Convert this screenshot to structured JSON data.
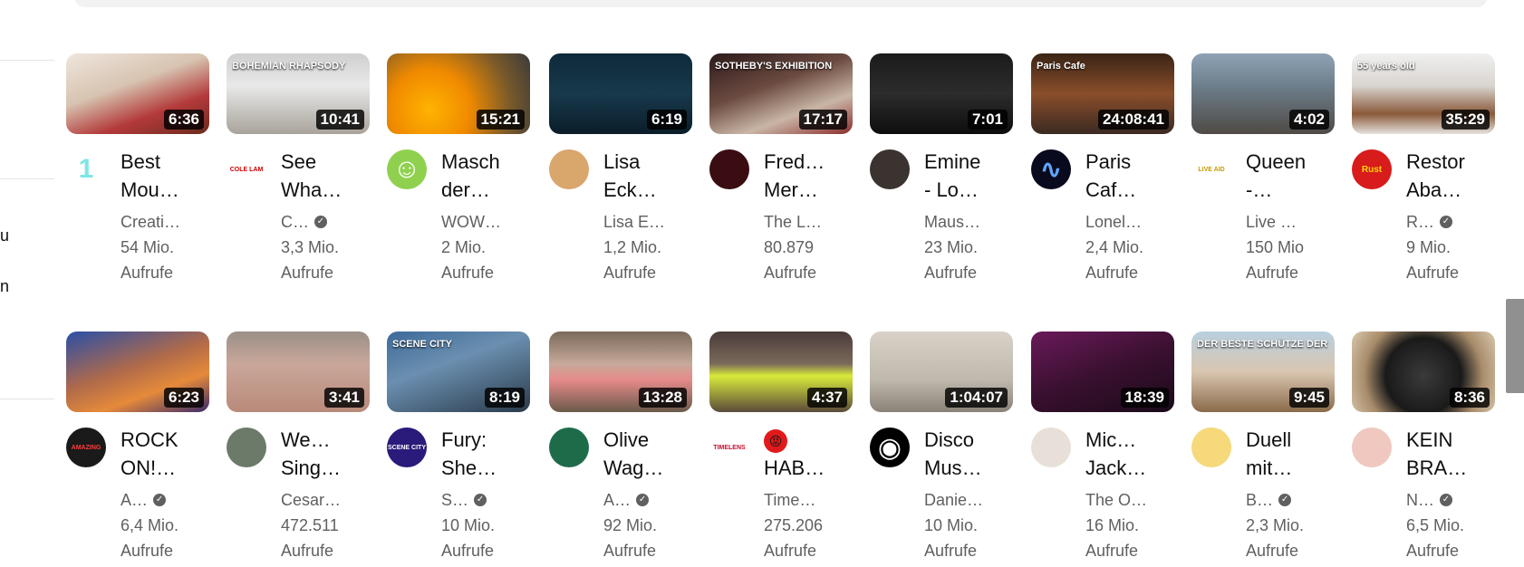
{
  "rail_texts": [
    "u",
    "n"
  ],
  "rows": [
    [
      {
        "duration": "6:36",
        "title1": "Best",
        "title2": "Mou…",
        "channel": "Creati…",
        "verified": false,
        "views": "54 Mio.",
        "views_unit": "Aufrufe",
        "avatar_text": "1",
        "thumb": "linear-gradient(160deg,#efe6de 0%,#d7c3b0 40%,#b33a3a 70%,#6b2b1e 100%)",
        "avatar_bg": "#ffffff",
        "avatar_fg": "#7fe6e6",
        "thumb_label": ""
      },
      {
        "duration": "10:41",
        "title1": "See",
        "title2": "Wha…",
        "channel": "C…",
        "verified": true,
        "views": "3,3 Mio.",
        "views_unit": "Aufrufe",
        "avatar_text": "COLE LAM",
        "thumb": "linear-gradient(180deg,#cfcfcf 0%,#e9e9e9 40%,#a8a39a 100%)",
        "avatar_bg": "#ffffff",
        "avatar_fg": "#d00000",
        "thumb_label": "BOHEMIAN RHAPSODY"
      },
      {
        "duration": "15:21",
        "title1": "Masch",
        "title2": "der…",
        "channel": "WOW…",
        "verified": false,
        "views": "2 Mio.",
        "views_unit": "Aufrufe",
        "avatar_text": "☺",
        "thumb": "radial-gradient(circle at 30% 70%,#ffb300 0%,#f08a00 35%,#7a5a2a 70%,#3a3a3a 100%)",
        "avatar_bg": "#8fd14f",
        "avatar_fg": "#ffffff",
        "thumb_label": ""
      },
      {
        "duration": "6:19",
        "title1": "Lisa",
        "title2": "Eckh…",
        "channel": "Lisa E…",
        "verified": false,
        "views": "1,2 Mio.",
        "views_unit": "Aufrufe",
        "avatar_text": "",
        "thumb": "linear-gradient(180deg,#0e2a3a 0%,#17394c 50%,#0b1d29 100%)",
        "avatar_bg": "#d9a66c",
        "avatar_fg": "#ffffff",
        "thumb_label": ""
      },
      {
        "duration": "17:17",
        "title1": "Freddie",
        "title2": "Mer…",
        "channel": "The L…",
        "verified": false,
        "views": "80.879",
        "views_unit": "Aufrufe",
        "avatar_text": "",
        "thumb": "linear-gradient(160deg,#2b1a1a 0%,#6b4a40 40%,#c9b6a6 70%,#8a2d2d 100%)",
        "avatar_bg": "#3a0d12",
        "avatar_fg": "#ffffff",
        "thumb_label": "SOTHEBY'S EXHIBITION"
      },
      {
        "duration": "7:01",
        "title1": "Emine",
        "title2": "- Los…",
        "channel": "Maus…",
        "verified": false,
        "views": "23 Mio.",
        "views_unit": "Aufrufe",
        "avatar_text": "",
        "thumb": "linear-gradient(180deg,#1b1b1b 0%,#2c2c2c 50%,#0d0d0d 100%)",
        "avatar_bg": "#3a3330",
        "avatar_fg": "#ffffff",
        "thumb_label": ""
      },
      {
        "duration": "24:08:41",
        "title1": "Paris",
        "title2": "Cafe…",
        "channel": "Lonel…",
        "verified": false,
        "views": "2,4 Mio.",
        "views_unit": "Aufrufe",
        "avatar_text": "∿",
        "thumb": "linear-gradient(180deg,#3a2416 0%,#8a4e2a 50%,#3b2a22 100%)",
        "avatar_bg": "#0a0a1e",
        "avatar_fg": "#5fa8ff",
        "thumb_label": "Paris Cafe"
      },
      {
        "duration": "4:02",
        "title1": "Queen",
        "title2": "-…",
        "channel": "Live …",
        "verified": false,
        "views": "150 Mio",
        "views_unit": "Aufrufe",
        "avatar_text": "LIVE AID",
        "thumb": "linear-gradient(180deg,#8fa3b5 0%,#6d7f8c 40%,#4f4a45 100%)",
        "avatar_bg": "#ffffff",
        "avatar_fg": "#c79a00",
        "thumb_label": ""
      },
      {
        "duration": "35:29",
        "title1": "Restor",
        "title2": "Aba…",
        "channel": "R…",
        "verified": true,
        "views": "9 Mio.",
        "views_unit": "Aufrufe",
        "avatar_text": "Rust",
        "thumb": "linear-gradient(180deg,#f0f0f0 0%,#d9d5d0 40%,#8a5a3a 75%,#e5e2de 100%)",
        "avatar_bg": "#d81b1b",
        "avatar_fg": "#ffd700",
        "thumb_label": "55 years old"
      }
    ],
    [
      {
        "duration": "6:23",
        "title1": "ROCK",
        "title2": "ON!…",
        "channel": "A…",
        "verified": true,
        "views": "6,4 Mio.",
        "views_unit": "Aufrufe",
        "avatar_text": "AMAZING",
        "thumb": "linear-gradient(160deg,#2a4fa8 0%,#b06a4a 45%,#e58a3a 70%,#3a2a6a 100%)",
        "avatar_bg": "#1a1a1a",
        "avatar_fg": "#ff3b3b",
        "thumb_label": ""
      },
      {
        "duration": "3:41",
        "title1": "Wembl",
        "title2": "Sing…",
        "channel": "Cesar…",
        "verified": false,
        "views": "472.511",
        "views_unit": "Aufrufe",
        "avatar_text": "",
        "thumb": "linear-gradient(180deg,#9a8f87 0%,#c9a79a 40%,#b98a7a 100%)",
        "avatar_bg": "#6c7a6a",
        "avatar_fg": "#ffffff",
        "thumb_label": ""
      },
      {
        "duration": "8:19",
        "title1": "Fury:",
        "title2": "Sher…",
        "channel": "S…",
        "verified": true,
        "views": "10 Mio.",
        "views_unit": "Aufrufe",
        "avatar_text": "SCENE CITY",
        "thumb": "linear-gradient(160deg,#3d6a9a 0%,#6b8fb0 40%,#2a3a4a 100%)",
        "avatar_bg": "#2a1a7a",
        "avatar_fg": "#ffffff",
        "thumb_label": "SCENE CITY"
      },
      {
        "duration": "13:28",
        "title1": "Olive",
        "title2": "Wag…",
        "channel": "A…",
        "verified": true,
        "views": "92 Mio.",
        "views_unit": "Aufrufe",
        "avatar_text": "",
        "thumb": "linear-gradient(180deg,#7a6a5a 0%,#c7a99a 40%,#e68a8a 60%,#6a5a4a 100%)",
        "avatar_bg": "#1e6b4a",
        "avatar_fg": "#ffd24d",
        "thumb_label": ""
      },
      {
        "duration": "4:37",
        "title1": "😡",
        "title2": "HAB…",
        "channel": "Time…",
        "verified": false,
        "views": "275.206",
        "views_unit": "Aufrufe",
        "avatar_text": "TIMELENS",
        "thumb": "linear-gradient(180deg,#4a3a3a 0%,#7a6a5a 40%,#d8ea3a 55%,#5a4a3a 100%)",
        "avatar_bg": "#ffffff",
        "avatar_fg": "#c8102e",
        "thumb_label": ""
      },
      {
        "duration": "1:04:07",
        "title1": "Disco",
        "title2": "Musi…",
        "channel": "Danie…",
        "verified": false,
        "views": "10 Mio.",
        "views_unit": "Aufrufe",
        "avatar_text": "◉",
        "thumb": "linear-gradient(180deg,#d8d2c8 0%,#bfb8ac 60%,#8a8278 100%)",
        "avatar_bg": "#000000",
        "avatar_fg": "#ffffff",
        "thumb_label": ""
      },
      {
        "duration": "18:39",
        "title1": "Michae",
        "title2": "Jack…",
        "channel": "The O…",
        "verified": false,
        "views": "16 Mio.",
        "views_unit": "Aufrufe",
        "avatar_text": "",
        "thumb": "linear-gradient(160deg,#6a1a5a 0%,#3a1030 50%,#1a0a1a 100%)",
        "avatar_bg": "#e8e0d8",
        "avatar_fg": "#333333",
        "thumb_label": ""
      },
      {
        "duration": "9:45",
        "title1": "Duell",
        "title2": "mit…",
        "channel": "B…",
        "verified": true,
        "views": "2,3 Mio.",
        "views_unit": "Aufrufe",
        "avatar_text": "",
        "thumb": "linear-gradient(180deg,#b8d0e0 0%,#d9c6b0 50%,#8a6a4a 100%)",
        "avatar_bg": "#f5d97a",
        "avatar_fg": "#a02020",
        "thumb_label": "DER BESTE SCHÜTZE DER WE"
      },
      {
        "duration": "8:36",
        "title1": "KEIN",
        "title2": "BRA…",
        "channel": "N…",
        "verified": true,
        "views": "6,5 Mio.",
        "views_unit": "Aufrufe",
        "avatar_text": "",
        "thumb": "radial-gradient(circle at 50% 55%,#3a3a3a 0%,#1a1a1a 45%,#a88c6a 70%,#d9c9b0 100%)",
        "avatar_bg": "#f0c8c0",
        "avatar_fg": "#333333",
        "thumb_label": ""
      }
    ]
  ]
}
